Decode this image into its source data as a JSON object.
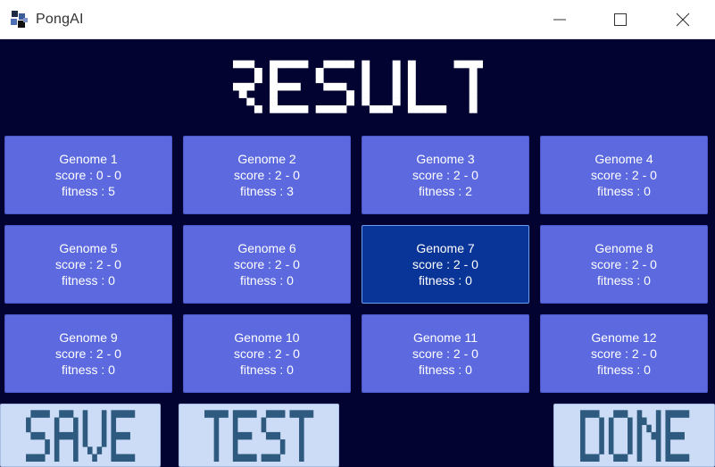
{
  "window": {
    "title": "PongAI",
    "icon": "pong-app-icon",
    "controls": [
      "minimize-icon",
      "maximize-icon",
      "close-icon"
    ]
  },
  "header": {
    "title": "RESULT"
  },
  "genomes": [
    {
      "name": "Genome 1",
      "score": "score : 0 - 0",
      "fitness": "fitness : 5",
      "selected": false
    },
    {
      "name": "Genome 2",
      "score": "score : 2 - 0",
      "fitness": "fitness : 3",
      "selected": false
    },
    {
      "name": "Genome 3",
      "score": "score : 2 - 0",
      "fitness": "fitness : 2",
      "selected": false
    },
    {
      "name": "Genome 4",
      "score": "score : 2 - 0",
      "fitness": "fitness : 0",
      "selected": false
    },
    {
      "name": "Genome 5",
      "score": "score : 2 - 0",
      "fitness": "fitness : 0",
      "selected": false
    },
    {
      "name": "Genome 6",
      "score": "score : 2 - 0",
      "fitness": "fitness : 0",
      "selected": false
    },
    {
      "name": "Genome 7",
      "score": "score : 2 - 0",
      "fitness": "fitness : 0",
      "selected": true
    },
    {
      "name": "Genome 8",
      "score": "score : 2 - 0",
      "fitness": "fitness : 0",
      "selected": false
    },
    {
      "name": "Genome 9",
      "score": "score : 2 - 0",
      "fitness": "fitness : 0",
      "selected": false
    },
    {
      "name": "Genome 10",
      "score": "score : 2 - 0",
      "fitness": "fitness : 0",
      "selected": false
    },
    {
      "name": "Genome 11",
      "score": "score : 2 - 0",
      "fitness": "fitness : 0",
      "selected": false
    },
    {
      "name": "Genome 12",
      "score": "score : 2 - 0",
      "fitness": "fitness : 0",
      "selected": false
    }
  ],
  "buttons": {
    "save": "SAVE",
    "test": "TEST",
    "done": "DONE"
  },
  "colors": {
    "background": "#030332",
    "card": "#5d6adf",
    "card_selected": "#0a3598",
    "button": "#ccdcf6",
    "button_text": "#2e5a80"
  }
}
